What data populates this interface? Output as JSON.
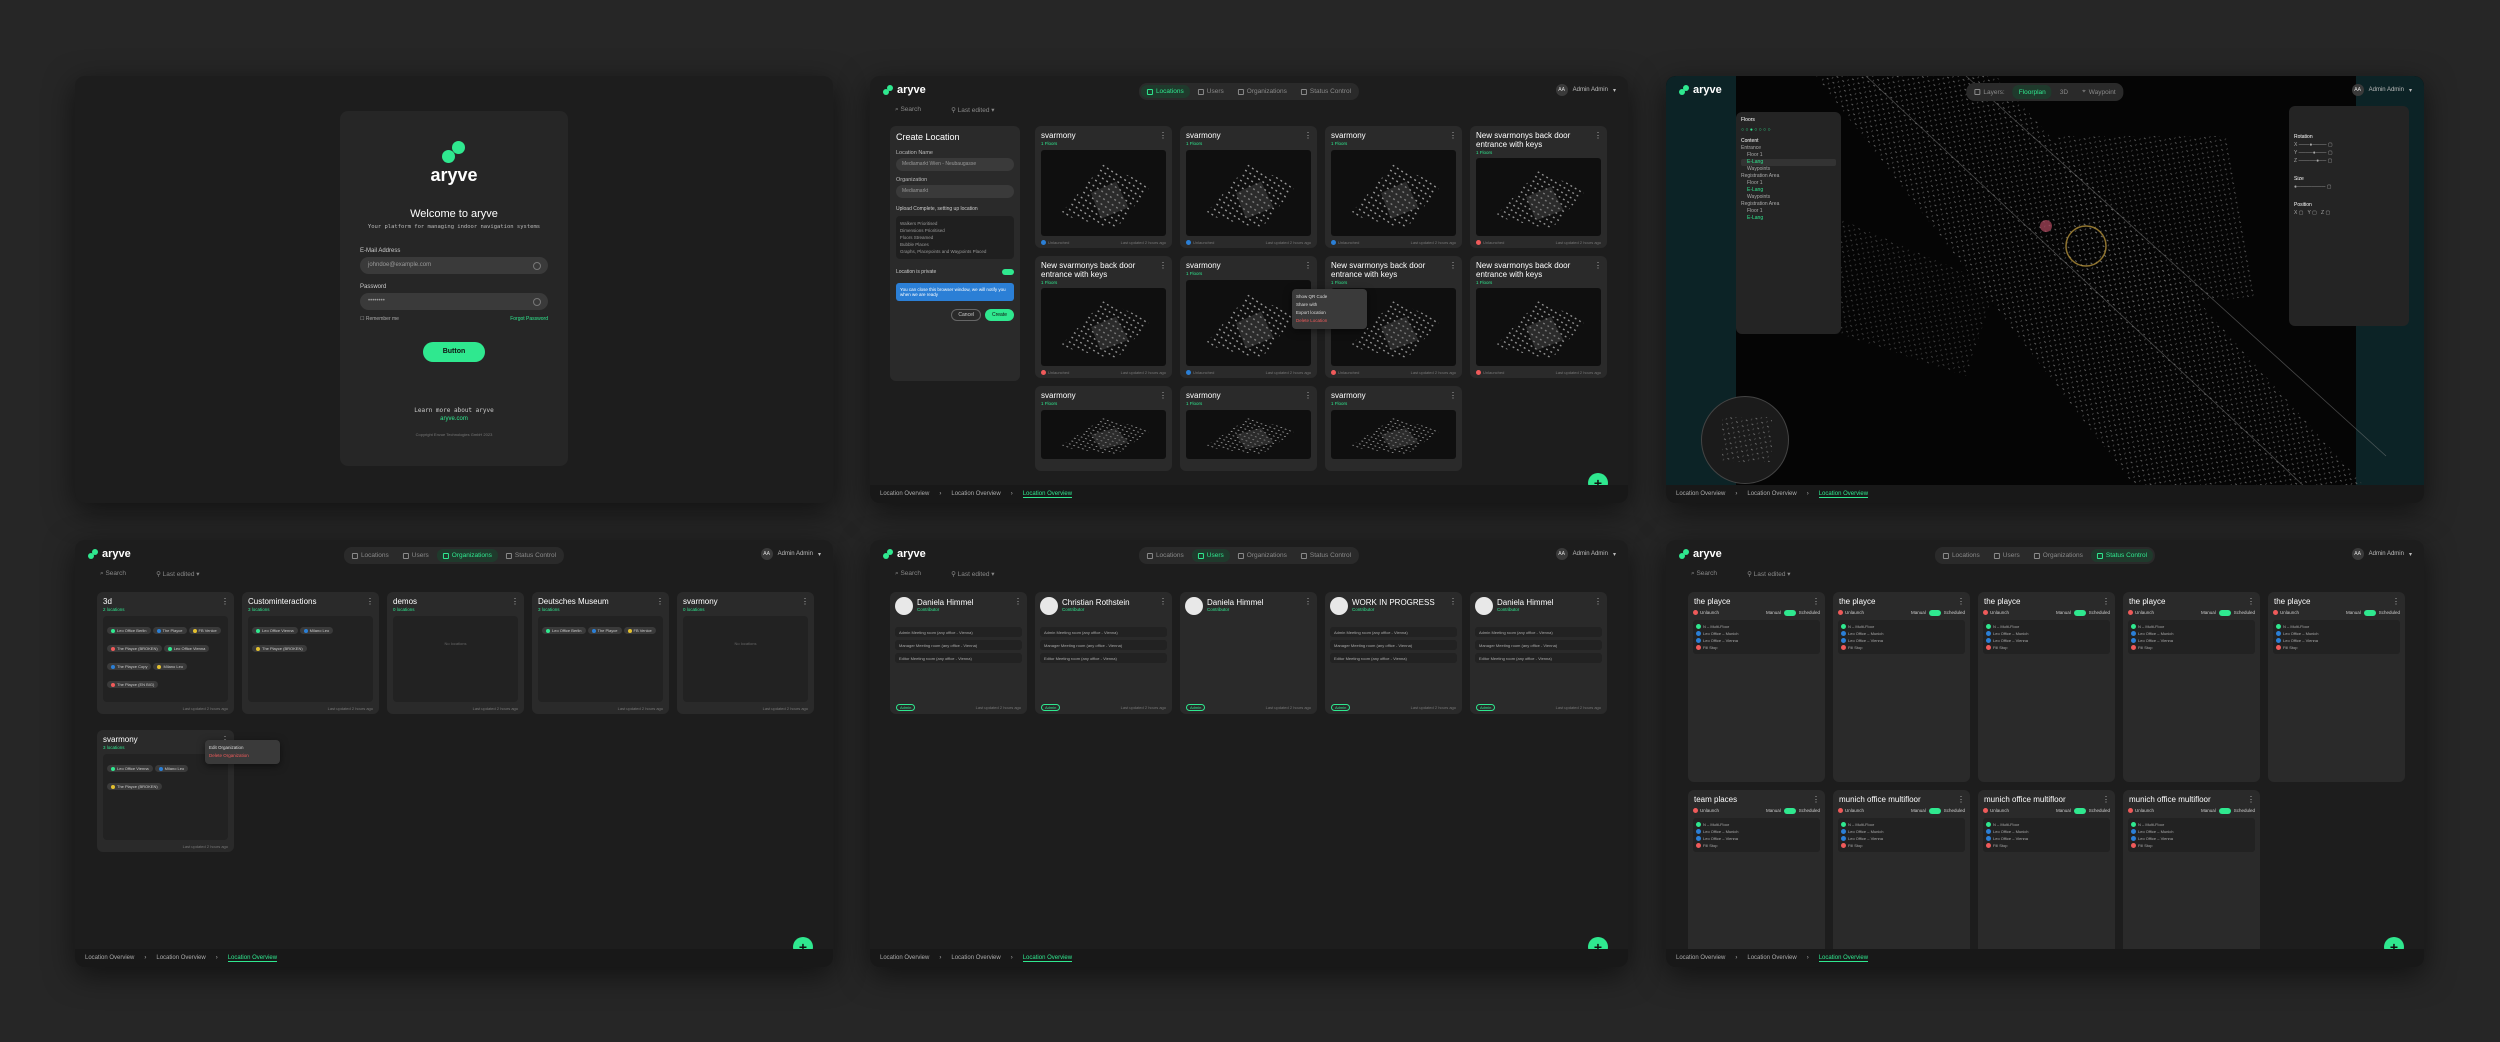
{
  "brand": "aryve",
  "accent": "#2fe88f",
  "nav": {
    "locations": "Locations",
    "users": "Users",
    "organizations": "Organizations",
    "status": "Status Control"
  },
  "user": {
    "initials": "AA",
    "name": "Admin Admin"
  },
  "toolbar": {
    "search": "Search",
    "sort": "Last edited"
  },
  "crumbs": [
    "Location Overview",
    "Location Overview",
    "Location Overview"
  ],
  "login": {
    "welcome": "Welcome to aryve",
    "subtitle": "Your platform for managing indoor navigation systems",
    "email_label": "E-Mail Address",
    "email_placeholder": "johndoe@example.com",
    "password_label": "Password",
    "password_value": "••••••••",
    "remember": "Remember me",
    "forgot": "Forgot Password",
    "button": "Button",
    "learn": "Learn more about aryve",
    "learn_link": "aryve.com",
    "copyright": "Copyright Envue Technologies GmbH 2023"
  },
  "create": {
    "title": "Create Location",
    "name_label": "Location Name",
    "name_value": "Mediamarkt Wien - Neubaugasse",
    "org_label": "Organization",
    "org_value": "Mediamarkt",
    "upload": "Upload Complete, setting up location",
    "steps": [
      "Walkers Prioritised",
      "Dimensions Prioritised",
      "Floors Streamed",
      "Bubble Places",
      "Graphs, Placepoints and Waypoints Placed"
    ],
    "private": "Location is private",
    "info": "You can close this browser window, we will notify you when we are ready",
    "cancel": "Cancel",
    "create": "Create"
  },
  "locations": [
    {
      "title": "svarmony",
      "sub": "1 Floors"
    },
    {
      "title": "svarmony",
      "sub": "1 Floors"
    },
    {
      "title": "svarmony",
      "sub": "1 Floors"
    },
    {
      "title": "New svarmonys back door entrance with keys",
      "sub": "1 Floors"
    },
    {
      "title": "New svarmonys back door entrance with keys",
      "sub": "1 Floors"
    },
    {
      "title": "svarmony",
      "sub": "1 Floors"
    },
    {
      "title": "New svarmonys back door entrance with keys",
      "sub": "1 Floors"
    },
    {
      "title": "New svarmonys back door entrance with keys",
      "sub": "1 Floors"
    },
    {
      "title": "svarmony",
      "sub": "1 Floors"
    },
    {
      "title": "svarmony",
      "sub": "1 Floors"
    },
    {
      "title": "svarmony",
      "sub": "1 Floors"
    }
  ],
  "card_foot": "Last updated 2 hours ago",
  "card_status": "Unlaunched",
  "ctx": {
    "qr": "Show QR Code",
    "share": "Share with",
    "export": "Export location",
    "delete": "Delete Location"
  },
  "map": {
    "layers": "Layers:",
    "floorplan": "Floorplan",
    "threed": "3D",
    "waypoint": "Waypoint",
    "floors": "Floors",
    "content": "Content",
    "rotation": "Rotation",
    "size": "Size",
    "position": "Position",
    "items": [
      "Entrance",
      "Floor 1",
      "E-Lang",
      "Waypoints",
      "Registration Area"
    ]
  },
  "orgs": [
    {
      "title": "3d",
      "sub": "2 locations",
      "chips": [
        "Leo Office Berlin",
        "The Playce",
        "FB Venice",
        "The Playce (BROKEN)",
        "Leo Office Vienna",
        "The Playce Copy",
        "Milano Leo",
        "The Playce (EN BIG)"
      ]
    },
    {
      "title": "Custominteractions",
      "sub": "3 locations",
      "chips": [
        "Leo Office Vienna",
        "Milano Leo",
        "The Playce (BROKEN)"
      ]
    },
    {
      "title": "demos",
      "sub": "0 locations",
      "chips": []
    },
    {
      "title": "Deutsches Museum",
      "sub": "3 locations",
      "chips": [
        "Leo Office Berlin",
        "The Playce",
        "FB Venice"
      ]
    },
    {
      "title": "svarmony",
      "sub": "0 locations",
      "chips": []
    },
    {
      "title": "svarmony",
      "sub": "3 locations",
      "chips": [
        "Leo Office Vienna",
        "Milano Leo",
        "The Playce (BROKEN)"
      ]
    }
  ],
  "org_empty": "No locations",
  "org_ctx": {
    "edit": "Edit Organization",
    "delete": "Delete Organization"
  },
  "users": [
    {
      "name": "Daniela Himmel",
      "role": "Contributor"
    },
    {
      "name": "Christian Rothstein",
      "role": "Contributor"
    },
    {
      "name": "Daniela Himmel",
      "role": "Contributor"
    },
    {
      "name": "WORK IN PROGRESS",
      "role": "Contributor"
    },
    {
      "name": "Daniela Himmel",
      "role": "Contributor"
    }
  ],
  "user_rows": [
    "Admin",
    "Manager",
    "Editor"
  ],
  "user_row_value": "Meeting room (any office - Vienna)",
  "status_cards": [
    {
      "title": "the playce"
    },
    {
      "title": "the playce"
    },
    {
      "title": "the playce"
    },
    {
      "title": "the playce"
    },
    {
      "title": "the playce"
    },
    {
      "title": "team places"
    },
    {
      "title": "munich office multifloor"
    },
    {
      "title": "munich office multifloor"
    },
    {
      "title": "munich office multifloor"
    }
  ],
  "status_labels": {
    "unlaunch": "Unlaunch",
    "manual": "Manual",
    "scheduled": "Scheduled"
  },
  "status_items": [
    "N – Multi-Floor",
    "Leo Office – Munich",
    "Leo Office – Vienna",
    "Fill Stop"
  ]
}
